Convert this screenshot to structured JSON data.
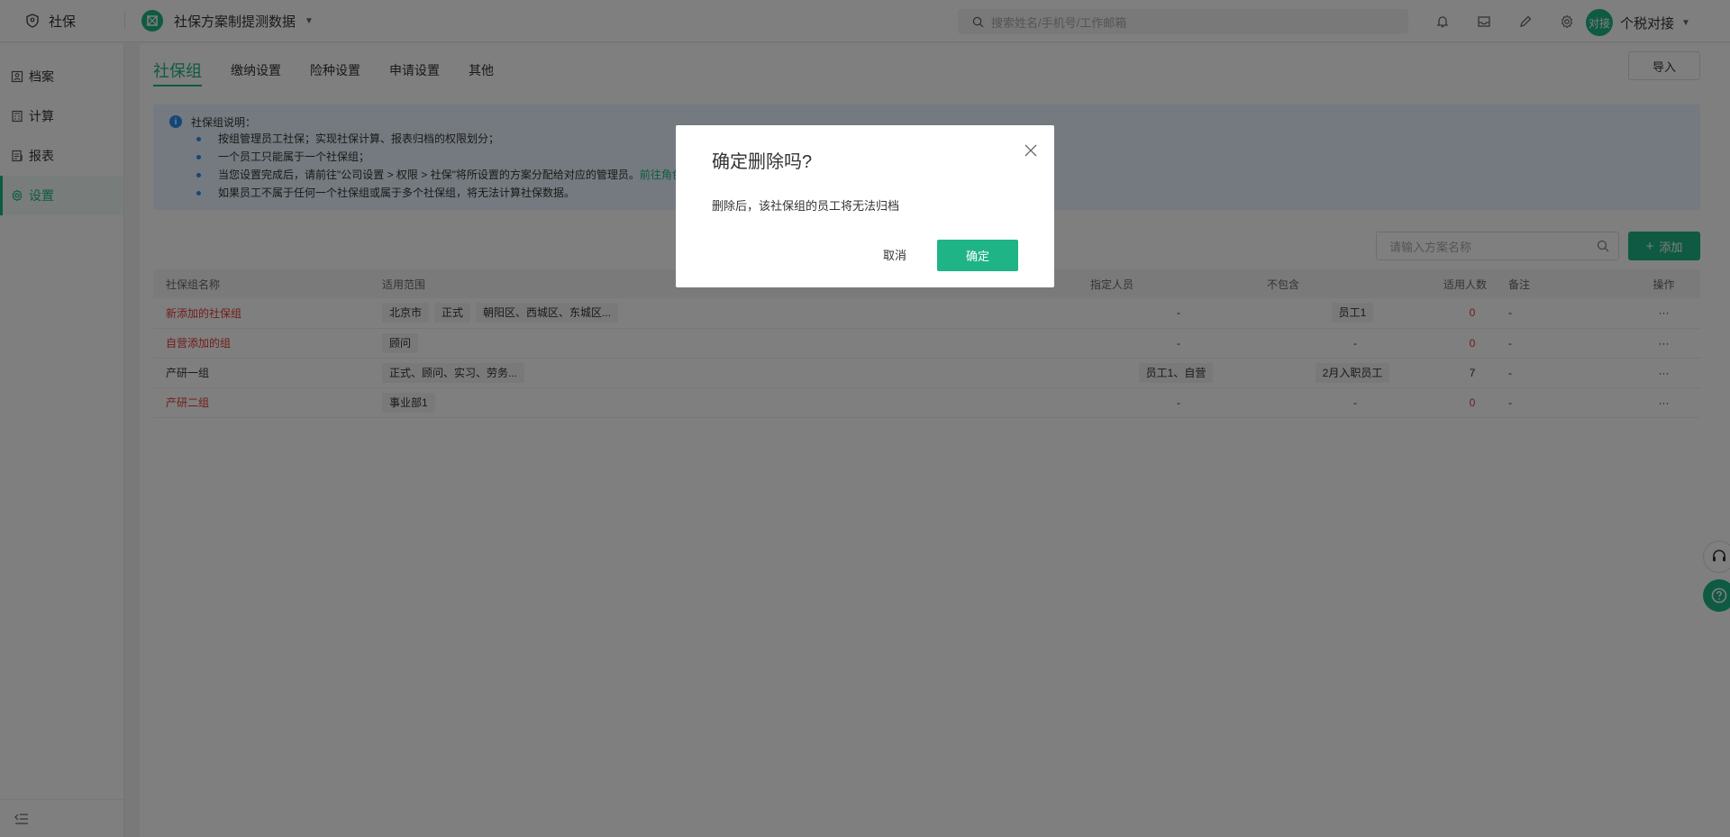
{
  "header": {
    "app_name": "社保",
    "company_name": "社保方案制提测数据",
    "search_placeholder": "搜索姓名/手机号/工作邮箱",
    "user_avatar_text": "对接",
    "user_name": "个税对接"
  },
  "sidebar": {
    "items": [
      {
        "label": "档案",
        "icon": "archive-icon"
      },
      {
        "label": "计算",
        "icon": "calculator-icon"
      },
      {
        "label": "报表",
        "icon": "report-icon"
      },
      {
        "label": "设置",
        "icon": "gear-icon",
        "active": true
      }
    ]
  },
  "tabs": [
    "社保组",
    "缴纳设置",
    "险种设置",
    "申请设置",
    "其他"
  ],
  "import_label": "导入",
  "notice": {
    "title": "社保组说明：",
    "items": [
      "按组管理员工社保；实现社保计算、报表归档的权限划分；",
      "一个员工只能属于一个社保组；",
      "当您设置完成后，请前往\"公司设置 > 权限 > 社保\"将所设置的方案分配给对应的管理员。",
      "如果员工不属于任何一个社保组或属于多个社保组，将无法计算社保数据。"
    ],
    "link": "前往角色"
  },
  "table_search_placeholder": "请输入方案名称",
  "add_label": "添加",
  "table": {
    "headers": [
      "社保组名称",
      "适用范围",
      "指定人员",
      "不包含",
      "适用人数",
      "备注",
      "操作"
    ],
    "rows": [
      {
        "name": "新添加的社保组",
        "scope": [
          "北京市",
          "正式",
          "朝阳区、西城区、东城区..."
        ],
        "assigned": "-",
        "excluded": "员工1",
        "count": "0",
        "note": "-",
        "ops": "···",
        "red": true
      },
      {
        "name": "自营添加的组",
        "scope": [
          "顾问"
        ],
        "assigned": "-",
        "excluded": "-",
        "count": "0",
        "note": "-",
        "ops": "···",
        "red": true
      },
      {
        "name": "产研一组",
        "scope": [
          "正式、顾问、实习、劳务..."
        ],
        "assigned": "员工1、自营",
        "excluded": "2月入职员工",
        "count": "7",
        "note": "-",
        "ops": "···",
        "red": false
      },
      {
        "name": "产研二组",
        "scope": [
          "事业部1"
        ],
        "assigned": "-",
        "excluded": "-",
        "count": "0",
        "note": "-",
        "ops": "···",
        "red": true
      }
    ]
  },
  "dialog": {
    "title": "确定删除吗?",
    "body": "删除后，该社保组的员工将无法归档",
    "cancel": "取消",
    "ok": "确定"
  },
  "colors": {
    "accent": "#1fb485",
    "danger": "#e53935",
    "info": "#2d8cf0"
  }
}
